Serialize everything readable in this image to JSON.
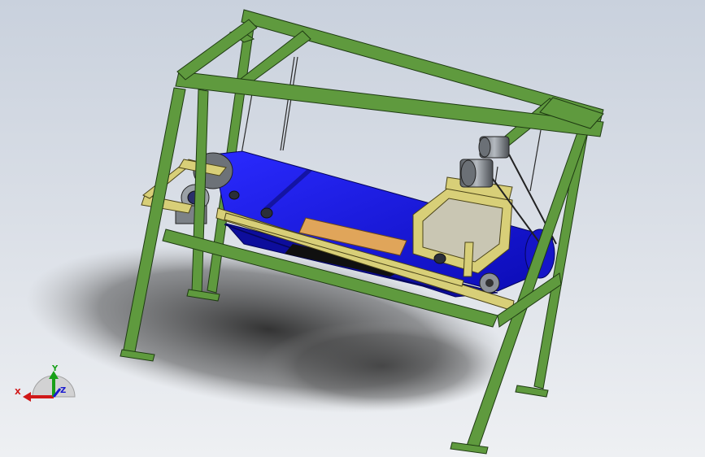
{
  "viewport": {
    "background_top": "#c9d1dd",
    "background_bottom": "#eef0f3"
  },
  "model": {
    "frame_color": "#5f9a3e",
    "frame_edge_color": "#1e3a12",
    "belt_color": "#1414e6",
    "carriage_color": "#d8cf78",
    "motor_color": "#8a8f95",
    "plate_color": "#e0a55a"
  },
  "triad": {
    "x_label": "X",
    "y_label": "Y",
    "z_label": "Z",
    "x_color": "#d01818",
    "y_color": "#18a018",
    "z_color": "#1818d0"
  }
}
